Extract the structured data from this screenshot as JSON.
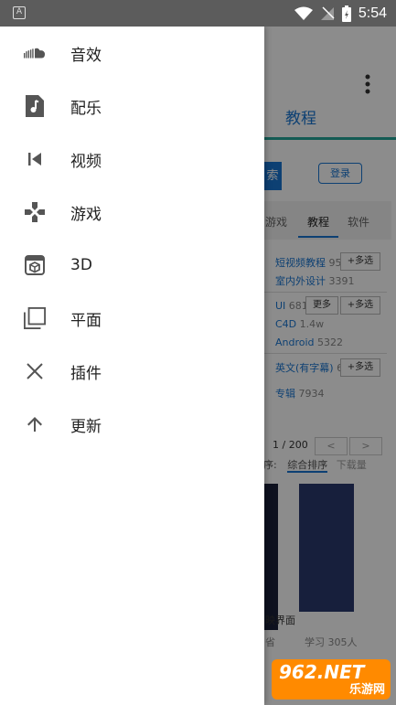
{
  "status_bar": {
    "time": "5:54",
    "left_icon_letter": "A"
  },
  "drawer": {
    "items": [
      {
        "label": "音效",
        "icon": "soundcloud-icon"
      },
      {
        "label": "配乐",
        "icon": "music-note-icon"
      },
      {
        "label": "视频",
        "icon": "skip-previous-icon"
      },
      {
        "label": "游戏",
        "icon": "gamepad-icon"
      },
      {
        "label": "3D",
        "icon": "printer-3d-icon"
      },
      {
        "label": "平面",
        "icon": "copy-icon"
      },
      {
        "label": "插件",
        "icon": "close-icon"
      },
      {
        "label": "更新",
        "icon": "arrow-up-icon"
      }
    ]
  },
  "background_app": {
    "title": "教程",
    "search_label": "索",
    "login_label": "登录",
    "tabs": [
      "游戏",
      "教程",
      "软件"
    ],
    "active_tab": "教程",
    "list": [
      {
        "name": "短视频教程",
        "count": "95"
      },
      {
        "name": "室内外设计",
        "count": "3391"
      },
      {
        "name": "UI",
        "count": "6817"
      },
      {
        "name": "C4D",
        "count": "1.4w"
      },
      {
        "name": "Android",
        "count": "5322"
      },
      {
        "name": "英文(有字幕)",
        "count": "6"
      },
      {
        "name": "专辑",
        "count": "7934"
      }
    ],
    "multi_select_label": "+多选",
    "more_label": "更多",
    "pager": {
      "page": "1 / 200",
      "prev": "<",
      "next": ">"
    },
    "sort": {
      "label": "序:",
      "option_active": "综合排序",
      "option_other": "下载量"
    },
    "captions": {
      "title": "映界面",
      "sub_left": "省",
      "learn": "学习 305人"
    }
  },
  "watermark": {
    "top": "962.NET",
    "bottom": "乐游网"
  },
  "colors": {
    "accent": "#1976d2",
    "teal": "#26a69a",
    "dim": "rgba(0,0,0,0.45)"
  }
}
